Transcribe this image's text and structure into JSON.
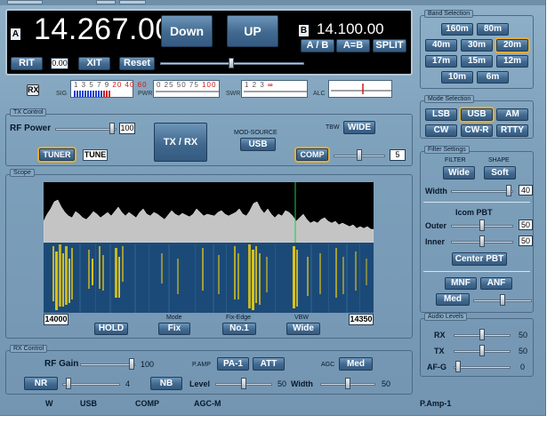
{
  "display": {
    "vfo_a_badge": "A",
    "vfo_b_badge": "B",
    "frequency_a": "14.267.00",
    "frequency_b": "14.100.00",
    "down_label": "Down",
    "up_label": "UP",
    "ab_label": "A / B",
    "aeqb_label": "A=B",
    "split_label": "SPLIT",
    "rit_label": "RIT",
    "rit_value": "0.00",
    "xit_label": "XIT",
    "reset_label": "Reset"
  },
  "meters": {
    "rx_label": "RX",
    "sig_label": "SIG",
    "sig_scale": "1 3 5 7 9",
    "sig_scale_over": "20 40 60",
    "pwr_label": "PWR",
    "pwr_scale": "0   25   50   75",
    "pwr_scale_over": "100",
    "swr_label": "SWR",
    "swr_scale": "1     2     3",
    "swr_scale_over": "∞",
    "alc_label": "ALC"
  },
  "tx_control": {
    "title": "TX Control",
    "rf_power_label": "RF Power",
    "rf_power_value": "100",
    "tx_rx_label": "TX / RX",
    "mod_source_label": "MOD-SOURCE",
    "mod_source_value": "USB",
    "tbw_label": "TBW",
    "tbw_value": "WIDE",
    "tuner_label": "TUNER",
    "tune_label": "TUNE",
    "comp_label": "COMP",
    "comp_value": "5"
  },
  "scope": {
    "title": "Scope",
    "freq_start": "14000",
    "freq_end": "14350",
    "hold_label": "HOLD",
    "mode_caption": "Mode",
    "mode_value": "Fix",
    "fix_edge_caption": "Fix-Edge",
    "fix_edge_value": "No.1",
    "vbw_caption": "VBW",
    "vbw_value": "Wide"
  },
  "rx_control": {
    "title": "RX Control",
    "rf_gain_label": "RF Gain",
    "rf_gain_value": "100",
    "pamp_label": "P.AMP",
    "pa1_label": "PA-1",
    "att_label": "ATT",
    "agc_label": "AGC",
    "agc_value": "Med",
    "nr_label": "NR",
    "nr_value": "4",
    "nb_label": "NB",
    "level_label": "Level",
    "level_value": "50",
    "width_label": "Width",
    "width_value": "50"
  },
  "band_selection": {
    "title": "Band Selection",
    "bands": [
      "160m",
      "80m",
      "40m",
      "30m",
      "20m",
      "17m",
      "15m",
      "12m",
      "10m",
      "6m"
    ],
    "selected": "20m"
  },
  "mode_selection": {
    "title": "Mode Selection",
    "modes": [
      "LSB",
      "USB",
      "AM",
      "CW",
      "CW-R",
      "RTTY"
    ],
    "selected": "USB"
  },
  "filter_settings": {
    "title": "Filter Settings",
    "filter_caption": "FILTER",
    "filter_value": "Wide",
    "shape_caption": "SHAPE",
    "shape_value": "Soft",
    "width_label": "Width",
    "width_value": "40",
    "pbt_caption": "Icom PBT",
    "outer_label": "Outer",
    "outer_value": "50",
    "inner_label": "Inner",
    "inner_value": "50",
    "center_pbt_label": "Center PBT",
    "mnf_label": "MNF",
    "anf_label": "ANF",
    "med_label": "Med"
  },
  "audio_levels": {
    "title": "Audio Levels",
    "rx_label": "RX",
    "rx_value": "50",
    "tx_label": "TX",
    "tx_value": "50",
    "afg_label": "AF-G",
    "afg_value": "0"
  },
  "status_bar": {
    "items": [
      "W",
      "USB",
      "COMP",
      "AGC-M"
    ],
    "pamp": "P.Amp-1"
  }
}
